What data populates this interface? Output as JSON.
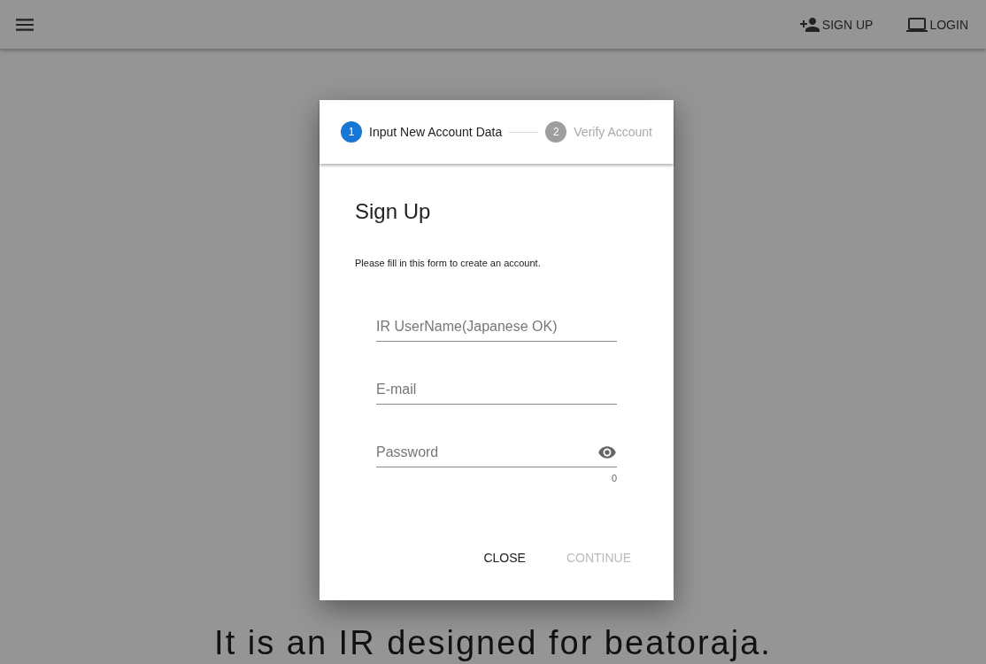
{
  "app_bar": {
    "actions": [
      {
        "kind": "signup",
        "label": "SIGN UP"
      },
      {
        "kind": "login",
        "label": "LOGIN"
      }
    ]
  },
  "tagline": "It is an IR designed for beatoraja.",
  "dialog": {
    "steps": [
      {
        "number": "1",
        "label": "Input New Account Data",
        "selected": true
      },
      {
        "number": "2",
        "label": "Verify Account",
        "selected": false
      }
    ],
    "title": "Sign Up",
    "description": "Please fill in this form to create an account.",
    "fields": [
      {
        "kind": "text",
        "placeholder": "IR UserName(Japanese OK)"
      },
      {
        "kind": "text",
        "placeholder": "E-mail"
      },
      {
        "kind": "password",
        "placeholder": "Password",
        "counter": "0"
      }
    ],
    "buttons": [
      {
        "label": "CLOSE",
        "disabled": false
      },
      {
        "label": "CONTINUE",
        "disabled": true
      }
    ]
  }
}
